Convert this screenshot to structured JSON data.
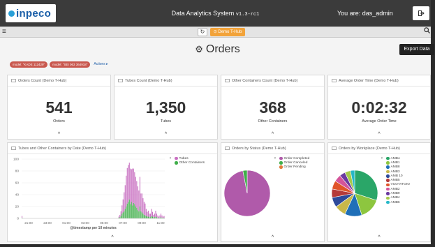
{
  "header": {
    "logo_text": "inpeco",
    "app_title": "Data Analytics System",
    "version": "v1.3-rc1",
    "user_label": "You are: das_admin",
    "logout_icon": "logout-icon"
  },
  "navbar": {
    "menu_icon": "hamburger-icon",
    "refresh_icon": "refresh-icon",
    "context_button": "⊙ Demo T-Hub",
    "search_icon": "search-icon"
  },
  "page": {
    "title": "Orders",
    "title_icon": "dashboard-icon",
    "export_label": "Export Data",
    "filters": [
      "model: \"KADE 112429\"",
      "model: \"SEI 063 364918\""
    ],
    "actions_label": "Actions ▸"
  },
  "metrics": [
    {
      "title": "Orders Count (Demo T-Hub)",
      "value": "541",
      "label": "Orders"
    },
    {
      "title": "Tubes Count (Demo T-Hub)",
      "value": "1,350",
      "label": "Tubes"
    },
    {
      "title": "Other Containers Count (Demo T-Hub)",
      "value": "368",
      "label": "Other Containers"
    },
    {
      "title": "Average Order Time (Demo T-Hub)",
      "value": "0:02:32",
      "label": "Average Order Time"
    }
  ],
  "panels": {
    "histogram_title": "Tubes and Other Containers by Date (Demo T-Hub)",
    "status_title": "Orders by Status (Demo T-Hub)",
    "workplace_title": "Orders by Workplace (Demo T-Hub)",
    "collapse_glyph": "^"
  },
  "chart_data": [
    {
      "type": "bar",
      "title": "Tubes and Other Containers by Date (Demo T-Hub)",
      "xlabel": "@timestamp per 10 minutes",
      "ylabel": "",
      "ylim": [
        0,
        100
      ],
      "yticks": [
        "0",
        "20",
        "40",
        "60",
        "80",
        "100"
      ],
      "xticks": [
        "21:00",
        "23:00",
        "01:00",
        "03:00",
        "05:00",
        "07:00",
        "09:00",
        "11:00"
      ],
      "stacked": true,
      "legend_position": "right",
      "series": [
        {
          "name": "Tubes",
          "color": "#c86fc1",
          "values": [
            3,
            0,
            0,
            0,
            0,
            0,
            0,
            0,
            0,
            0,
            0,
            0,
            0,
            0,
            0,
            0,
            0,
            0,
            0,
            0,
            0,
            0,
            0,
            0,
            0,
            0,
            0,
            0,
            0,
            0,
            0,
            0,
            0,
            0,
            0,
            0,
            0,
            0,
            0,
            0,
            0,
            0,
            0,
            0,
            0,
            0,
            0,
            0,
            0,
            0,
            0,
            0,
            0,
            0,
            0,
            0,
            0,
            0,
            0,
            0,
            0,
            0,
            0,
            0,
            0,
            0,
            0,
            0,
            0,
            0,
            0,
            0,
            0,
            0,
            0,
            0,
            0,
            0,
            0,
            0,
            0,
            0,
            0,
            0,
            0,
            0,
            0,
            0,
            0,
            0,
            0,
            0,
            2,
            4,
            8,
            14,
            22,
            32,
            40,
            52,
            60,
            62,
            62,
            60,
            55,
            62,
            58,
            54,
            50,
            45,
            40,
            35,
            50,
            30,
            32,
            26,
            22,
            20,
            12,
            8,
            10,
            6,
            6,
            12,
            8,
            4,
            6,
            10,
            6,
            4,
            2,
            4,
            6,
            4,
            2,
            3
          ]
        },
        {
          "name": "Other Containers",
          "color": "#3fae49",
          "values": [
            1,
            0,
            0,
            0,
            0,
            0,
            0,
            0,
            0,
            0,
            0,
            0,
            0,
            0,
            0,
            0,
            0,
            0,
            0,
            0,
            0,
            0,
            0,
            0,
            0,
            0,
            0,
            0,
            0,
            0,
            0,
            0,
            0,
            0,
            0,
            0,
            0,
            0,
            0,
            0,
            0,
            0,
            0,
            0,
            0,
            0,
            0,
            0,
            0,
            0,
            0,
            0,
            0,
            0,
            0,
            0,
            0,
            0,
            0,
            0,
            0,
            0,
            0,
            0,
            0,
            0,
            0,
            0,
            0,
            0,
            0,
            0,
            0,
            0,
            0,
            0,
            0,
            0,
            0,
            0,
            0,
            0,
            0,
            0,
            0,
            0,
            0,
            0,
            0,
            0,
            0,
            0,
            1,
            2,
            4,
            8,
            10,
            12,
            16,
            20,
            25,
            28,
            32,
            24,
            28,
            22,
            26,
            24,
            20,
            18,
            14,
            12,
            20,
            12,
            10,
            8,
            6,
            5,
            4,
            3,
            3,
            2,
            2,
            4,
            3,
            2,
            2,
            3,
            2,
            1,
            1,
            1,
            2,
            1,
            1,
            1
          ]
        }
      ]
    },
    {
      "type": "pie",
      "title": "Orders by Status (Demo T-Hub)",
      "legend_position": "right",
      "slices": [
        {
          "label": "Order Completed",
          "value": 97,
          "color": "#b05aaa"
        },
        {
          "label": "Order Canceled",
          "value": 3,
          "color": "#3fae49"
        },
        {
          "label": "Order Pending",
          "value": 0,
          "color": "#e07b39"
        }
      ]
    },
    {
      "type": "pie",
      "title": "Orders by Workplace (Demo T-Hub)",
      "legend_position": "right",
      "slices": [
        {
          "label": "AMBA",
          "value": 30,
          "color": "#2aa668"
        },
        {
          "label": "AMB1",
          "value": 15,
          "color": "#8dc63f"
        },
        {
          "label": "AMB8",
          "value": 12,
          "color": "#1f6fb8"
        },
        {
          "label": "AMB3",
          "value": 8,
          "color": "#c8b84a"
        },
        {
          "label": "AMB 10",
          "value": 7,
          "color": "#2e4a9a"
        },
        {
          "label": "AMB5",
          "value": 6,
          "color": "#b53a3a"
        },
        {
          "label": "VUOTATOIO",
          "value": 6,
          "color": "#e0542a"
        },
        {
          "label": "AMB2",
          "value": 5,
          "color": "#d4549a"
        },
        {
          "label": "AMB9",
          "value": 4,
          "color": "#6b3aa0"
        },
        {
          "label": "AMB4",
          "value": 4,
          "color": "#a6c94a"
        },
        {
          "label": "AMB6",
          "value": 3,
          "color": "#26b8c8"
        }
      ]
    }
  ]
}
